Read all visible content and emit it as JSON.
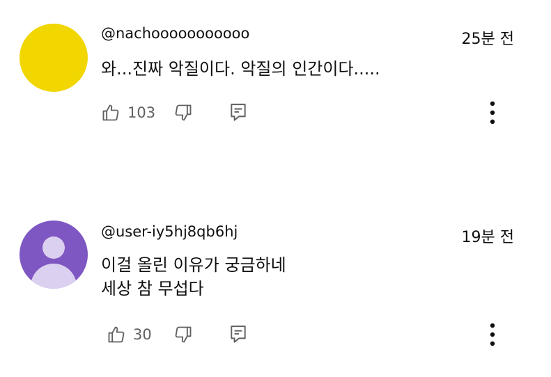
{
  "comments": [
    {
      "handle": "@nachooooooooooo",
      "time": "25분 전",
      "lines": [
        "와...진짜 악질이다. 악질의 인간이다....."
      ],
      "likes": "103",
      "avatar_color": "#f1d600"
    },
    {
      "handle": "@user-iy5hj8qb6hj",
      "time": "19분 전",
      "lines": [
        "이걸 올린 이유가 궁금하네",
        "세상 참 무섭다"
      ],
      "likes": "30",
      "avatar_color": "#7e57c2"
    }
  ],
  "icons": {
    "like": "thumbs-up-icon",
    "dislike": "thumbs-down-icon",
    "reply": "reply-icon",
    "more": "more-vertical-icon"
  },
  "colors": {
    "text": "#0f0f0f",
    "secondary_text": "#606060",
    "icon": "#606060"
  }
}
